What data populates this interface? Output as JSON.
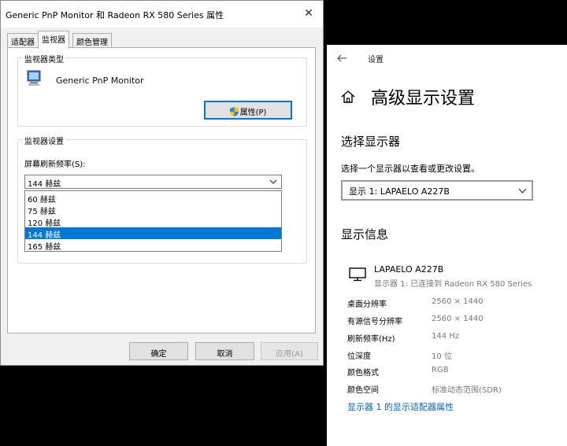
{
  "dialog": {
    "title": "Generic PnP Monitor 和 Radeon RX 580 Series 属性",
    "close": "✕",
    "tabs": [
      {
        "label": "适配器",
        "active": false
      },
      {
        "label": "监视器",
        "active": true
      },
      {
        "label": "颜色管理",
        "active": false
      }
    ],
    "monitor_type": {
      "legend": "监视器类型",
      "name": "Generic PnP Monitor",
      "properties_button": "属性(P)"
    },
    "monitor_settings": {
      "legend": "监视器设置",
      "refresh_label": "屏幕刷新频率(S):",
      "refresh_selected": "144 赫兹",
      "refresh_options": [
        "60 赫兹",
        "75 赫兹",
        "120 赫兹",
        "144 赫兹",
        "165 赫兹"
      ],
      "highlighted_option": "144 赫兹"
    },
    "buttons": {
      "ok": "确定",
      "cancel": "取消",
      "apply": "应用(A)"
    }
  },
  "settings": {
    "breadcrumb": "设置",
    "page_title": "高级显示设置",
    "select_display": {
      "heading": "选择显示器",
      "description": "选择一个显示器以查看或更改设置。",
      "selected": "显示 1: LAPAELO A227B"
    },
    "display_info": {
      "heading": "显示信息",
      "monitor_name": "LAPAELO A227B",
      "monitor_connection": "显示器 1: 已连接到 Radeon RX 580 Series",
      "rows": [
        {
          "key": "桌面分辨率",
          "value": "2560 × 1440"
        },
        {
          "key": "有源信号分辨率",
          "value": "2560 × 1440"
        },
        {
          "key": "刷新频率(Hz)",
          "value": "144 Hz"
        },
        {
          "key": "位深度",
          "value": "10 位"
        },
        {
          "key": "颜色格式",
          "value": "RGB"
        },
        {
          "key": "颜色空间",
          "value": "标准动态范围(SDR)"
        }
      ],
      "adapter_link": "显示器 1 的显示适配器属性"
    }
  },
  "colors": {
    "accent": "#0078d7",
    "link": "#0067c0",
    "dialog_bg": "#f0f0f0",
    "page_bg": "#000000"
  },
  "icons": [
    "close-icon",
    "monitor-icon",
    "shield-icon",
    "chevron-down-icon",
    "back-arrow-icon",
    "home-icon"
  ]
}
